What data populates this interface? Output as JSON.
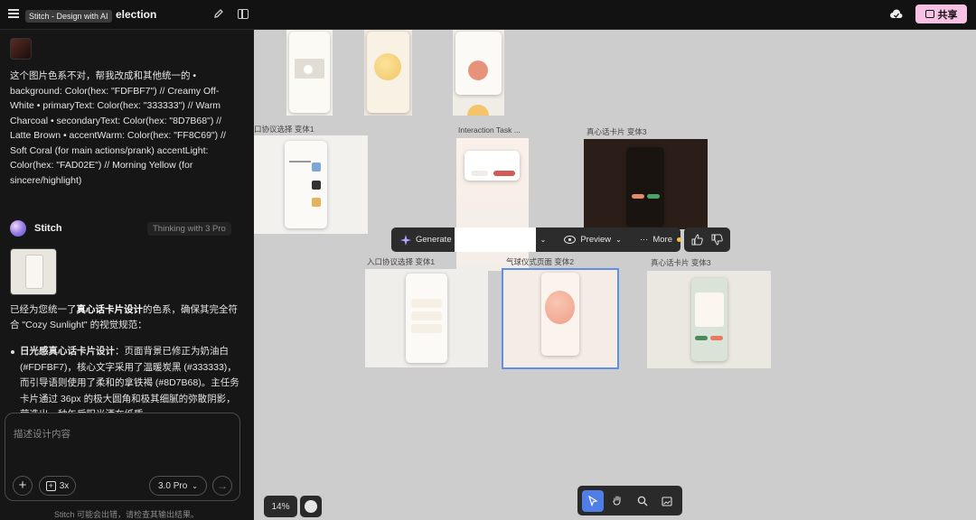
{
  "header": {
    "tooltip": "Stitch - Design with AI",
    "project_title": "election",
    "share_label": "共享"
  },
  "chat": {
    "user_message": "这个图片色系不对，帮我改成和其他统一的 • background: Color(hex: \"FDFBF7\") // Creamy Off-White • primaryText: Color(hex: \"333333\") // Warm Charcoal • secondaryText: Color(hex: \"8D7B68\") // Latte Brown • accentWarm: Color(hex: \"FF8C69\") // Soft Coral (for main actions/prank) accentLight: Color(hex: \"FAD02E\") // Morning Yellow (for sincere/highlight)",
    "assistant_name": "Stitch",
    "thinking_label": "Thinking with 3 Pro",
    "reply_prefix": "已经为您统一了",
    "reply_bold": "真心话卡片设计",
    "reply_suffix": "的色系，确保其完全符合 \"Cozy Sunlight\" 的视觉规范：",
    "bullet_bold": "日光感真心话卡片设计",
    "bullet_text": "：页面背景已修正为奶油白 (#FDFBF7)，核心文字采用了温暖炭黑 (#333333)，而引导语则使用了柔和的拿铁褐 (#8D7B68)。主任务卡片通过 36px 的极大圆角和极其细腻的弥散阴影，营造出一种午后阳光洒在纸质"
  },
  "composer": {
    "placeholder": "描述设计内容",
    "multiplier_label": "3x",
    "model_label": "3.0 Pro",
    "disclaimer": "Stitch 可能会出错，请检查其输出结果。"
  },
  "canvas": {
    "frames": [
      {
        "label": "口协议选择 变体1"
      },
      {
        "label": "Interaction Task ..."
      },
      {
        "label": "真心话卡片 变体3"
      },
      {
        "label": "入口协议选择 变体1"
      },
      {
        "label": "气球仪式页面 变体2"
      },
      {
        "label": "真心话卡片 变体3"
      }
    ],
    "toolbar": {
      "generate_label": "Generate",
      "preview_label": "Preview",
      "more_label": "More"
    },
    "zoom_label": "14%"
  }
}
